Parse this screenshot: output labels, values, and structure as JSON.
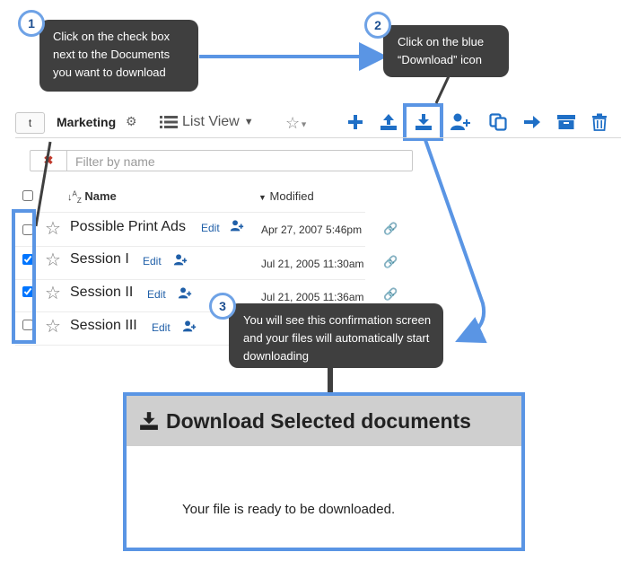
{
  "toolbar": {
    "t_button": "t",
    "folder_name": "Marketing",
    "view_label": "List View"
  },
  "filter": {
    "placeholder": "Filter by name"
  },
  "table": {
    "col_name": "Name",
    "col_modified": "Modified",
    "rows": [
      {
        "name": "Possible Print Ads",
        "edit": "Edit",
        "modified": "Apr 27, 2007 5:46pm",
        "checked": false
      },
      {
        "name": "Session I",
        "edit": "Edit",
        "modified": "Jul 21, 2005 11:30am",
        "checked": true
      },
      {
        "name": "Session II",
        "edit": "Edit",
        "modified": "Jul 21, 2005 11:36am",
        "checked": true
      },
      {
        "name": "Session III",
        "edit": "Edit",
        "modified": "",
        "checked": false
      }
    ]
  },
  "callouts": {
    "step1": {
      "number": "1",
      "text": "Click on the check box next to the Documents you want to download"
    },
    "step2": {
      "number": "2",
      "text": "Click on the blue “Download” icon"
    },
    "step3": {
      "number": "3",
      "text": "You will see this confirmation screen and your files will automatically start downloading"
    }
  },
  "dialog": {
    "title": "Download Selected documents",
    "message": "Your file is ready to be downloaded."
  },
  "colors": {
    "accent": "#1f6fc6",
    "annotation_blue": "#5a95e4",
    "callout_bg": "#3f3f3f"
  },
  "icons": [
    "plus-icon",
    "upload-icon",
    "download-icon",
    "add-user-icon",
    "copy-icon",
    "move-arrow-icon",
    "archive-icon",
    "trash-icon"
  ]
}
